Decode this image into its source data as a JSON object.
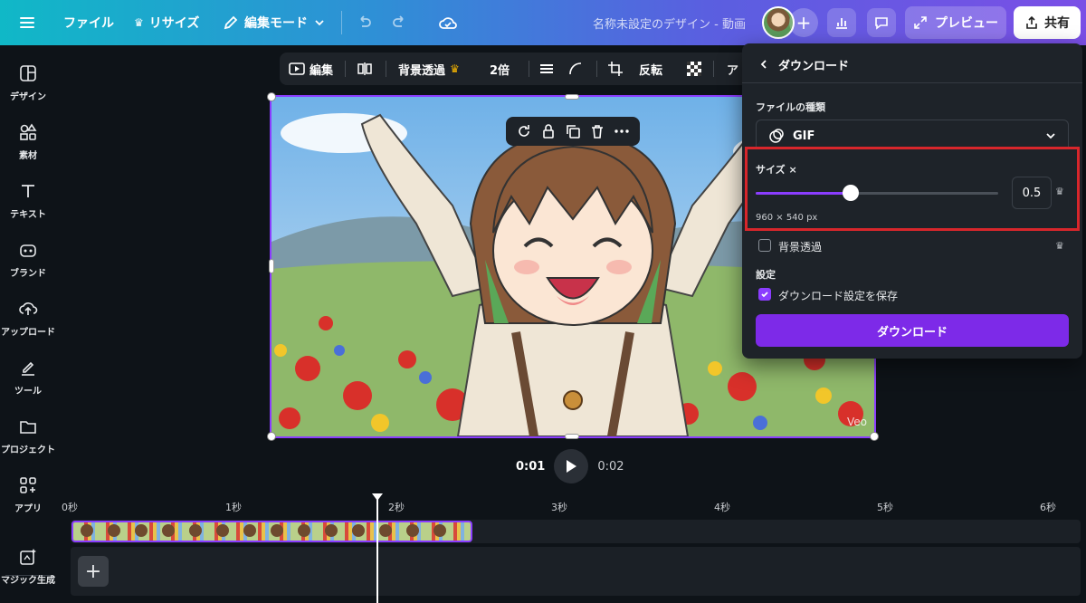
{
  "topbar": {
    "file": "ファイル",
    "resize": "リサイズ",
    "edit_mode": "編集モード",
    "doc_title": "名称未設定のデザイン - 動画",
    "preview": "プレビュー",
    "share": "共有"
  },
  "sidebar": {
    "items": [
      {
        "label": "デザイン",
        "icon": "layout-icon"
      },
      {
        "label": "素材",
        "icon": "shapes-icon"
      },
      {
        "label": "テキスト",
        "icon": "text-icon"
      },
      {
        "label": "ブランド",
        "icon": "brand-icon"
      },
      {
        "label": "アップロード",
        "icon": "upload-icon"
      },
      {
        "label": "ツール",
        "icon": "pen-icon"
      },
      {
        "label": "プロジェクト",
        "icon": "folder-icon"
      },
      {
        "label": "アプリ",
        "icon": "apps-icon"
      },
      {
        "label": "マジック生成",
        "icon": "magic-icon"
      }
    ]
  },
  "context_toolbar": {
    "edit": "編集",
    "bg_remove": "背景透過",
    "speed": "2倍",
    "flip": "反転",
    "anim": "ア"
  },
  "canvas": {
    "watermark": "Veo"
  },
  "playback": {
    "current": "0:01",
    "total": "0:02"
  },
  "timeline": {
    "ticks": [
      "0秒",
      "1秒",
      "2秒",
      "3秒",
      "4秒",
      "5秒",
      "6秒"
    ]
  },
  "download_panel": {
    "title": "ダウンロード",
    "file_type_label": "ファイルの種類",
    "file_type_value": "GIF",
    "size_label": "サイズ ×",
    "size_value": "0.5",
    "size_fraction": 0.39,
    "dimensions": "960 × 540 px",
    "bg_transparent": "背景透過",
    "settings_label": "設定",
    "save_settings": "ダウンロード設定を保存",
    "download_button": "ダウンロード"
  },
  "colors": {
    "accent": "#8b3dff",
    "highlight": "#d8262b"
  }
}
